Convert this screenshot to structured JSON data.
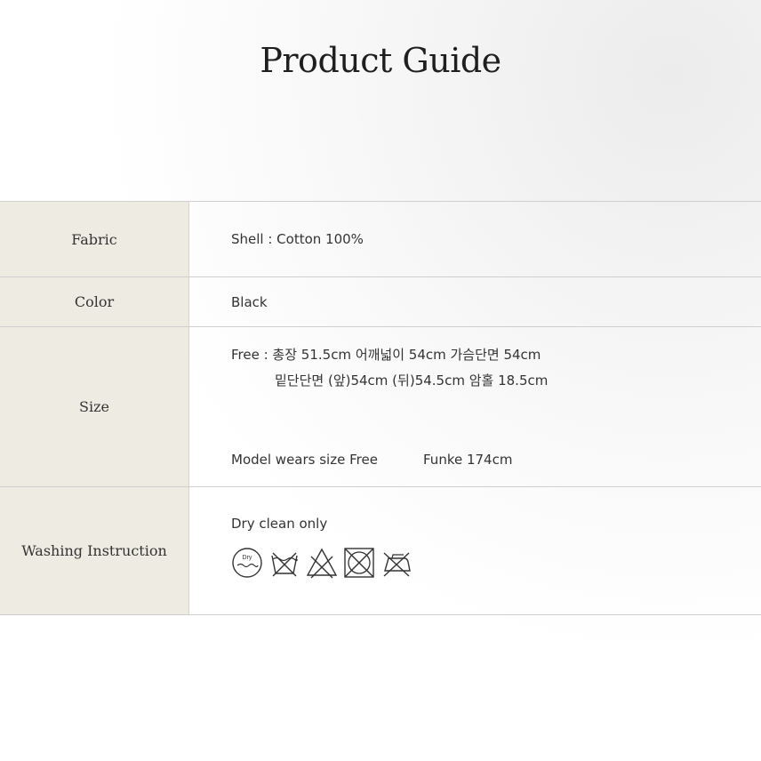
{
  "title": "Product Guide",
  "rows": {
    "fabric": {
      "label": "Fabric",
      "value": "Shell : Cotton 100%"
    },
    "color": {
      "label": "Color",
      "value": "Black"
    },
    "size": {
      "label": "Size",
      "line1": "Free : 총장 51.5cm 어깨넓이 54cm 가슴단면 54cm",
      "line2": "밑단단면 (앞)54cm (뒤)54.5cm 암홀 18.5cm",
      "model": "Model wears size Free",
      "model_name": "Funke 174cm"
    },
    "washing": {
      "label": "Washing Instruction",
      "value": "Dry clean only",
      "icons": [
        {
          "name": "dry-clean-icon",
          "text": "Dry"
        },
        {
          "name": "do-not-wash-icon"
        },
        {
          "name": "do-not-bleach-icon"
        },
        {
          "name": "do-not-tumble-dry-icon"
        },
        {
          "name": "do-not-iron-icon"
        }
      ]
    }
  }
}
